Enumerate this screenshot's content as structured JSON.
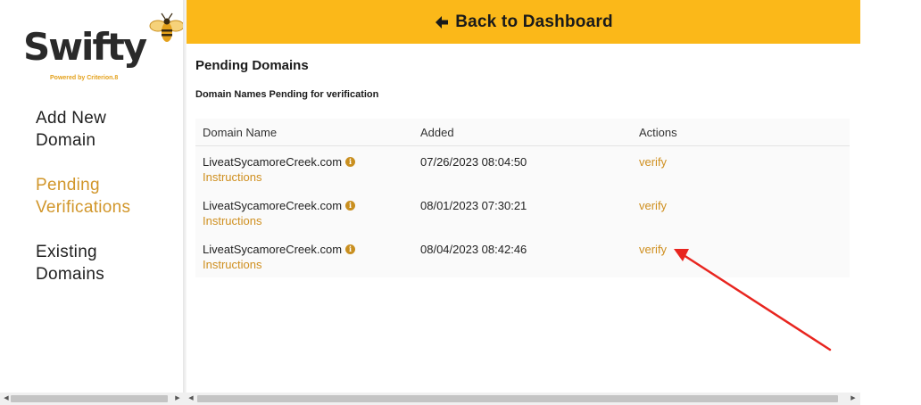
{
  "sidebar": {
    "logo": {
      "word": "Swifty",
      "tagline": "Powered by Criterion.8"
    },
    "items": [
      {
        "label": "Add New\nDomain"
      },
      {
        "label": "Pending\nVerifications"
      },
      {
        "label": "Existing\nDomains"
      }
    ]
  },
  "topbar": {
    "back_label": "Back to Dashboard",
    "icon": "arrow-left-icon"
  },
  "main": {
    "title": "Pending Domains",
    "subtitle": "Domain Names Pending for verification",
    "table": {
      "headers": [
        "Domain Name",
        "Added",
        "Actions"
      ],
      "rows": [
        {
          "domain": "LiveatSycamoreCreek.com",
          "instructions": "Instructions",
          "added": "07/26/2023 08:04:50",
          "action": "verify"
        },
        {
          "domain": "LiveatSycamoreCreek.com",
          "instructions": "Instructions",
          "added": "08/01/2023 07:30:21",
          "action": "verify"
        },
        {
          "domain": "LiveatSycamoreCreek.com",
          "instructions": "Instructions",
          "added": "08/04/2023 08:42:46",
          "action": "verify"
        }
      ]
    }
  },
  "colors": {
    "accent_yellow": "#fbb819",
    "link_gold": "#cf8f1f",
    "active_nav": "#d1962a",
    "annotation_red": "#e8251f"
  }
}
